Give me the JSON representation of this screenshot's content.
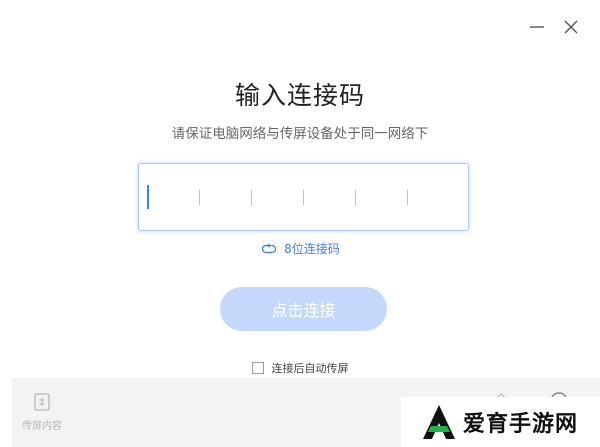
{
  "window": {
    "minimize_icon": "minimize-icon",
    "close_icon": "close-icon"
  },
  "main": {
    "title": "输入连接码",
    "subtitle": "请保证电脑网络与传屏设备处于同一网络下",
    "code_input": {
      "value": "",
      "slot_count": 6
    },
    "toggle_digits_label": "8位连接码",
    "connect_button_label": "点击连接",
    "auto_cast_label": "连接后自动传屏",
    "auto_cast_checked": false
  },
  "footer": {
    "cast_content_label": "传屏内容"
  },
  "watermark": {
    "text": "爱育手游网"
  },
  "colors": {
    "accent": "#3b82f6",
    "link": "#3f7ee8",
    "button_disabled": "#c4d8fb",
    "footer_bg": "#f3f3f3"
  }
}
